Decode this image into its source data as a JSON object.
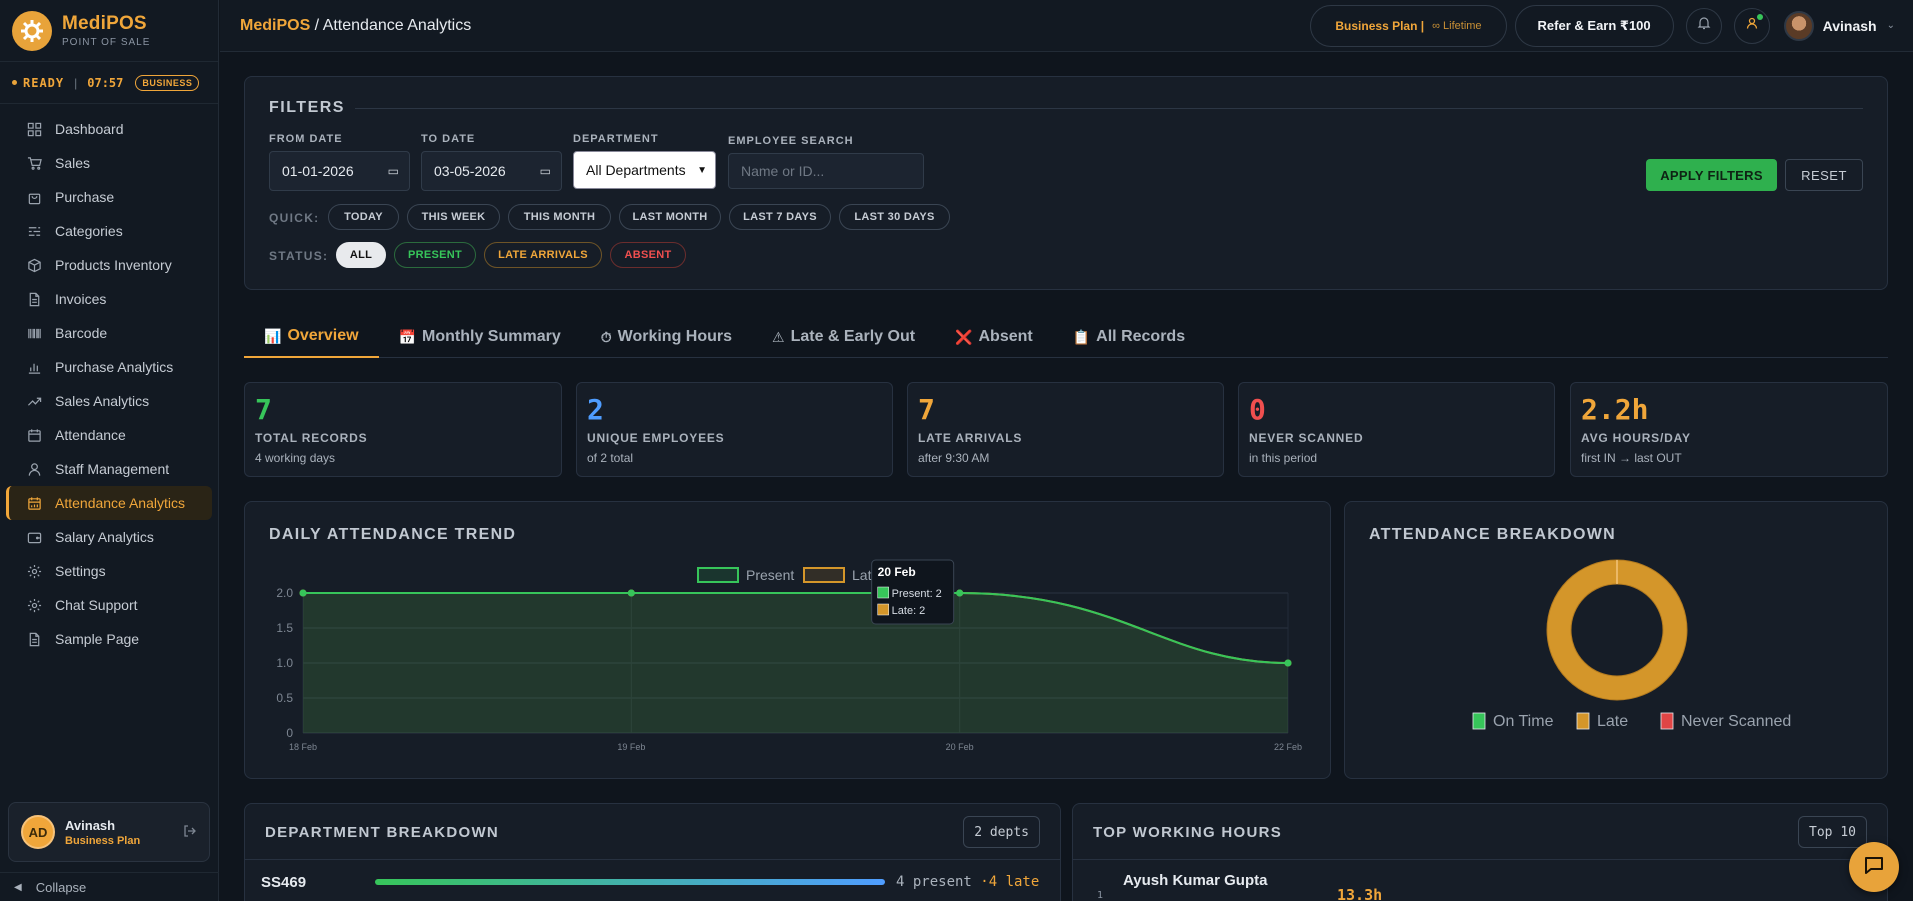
{
  "brand": {
    "title": "MediPOS",
    "subtitle": "POINT OF SALE"
  },
  "status": {
    "state": "READY",
    "time": "07:57",
    "badge": "BUSINESS"
  },
  "sidebar": {
    "items": [
      {
        "label": "Dashboard",
        "icon": "grid-icon"
      },
      {
        "label": "Sales",
        "icon": "cart-icon"
      },
      {
        "label": "Purchase",
        "icon": "bag-icon"
      },
      {
        "label": "Categories",
        "icon": "sliders-icon"
      },
      {
        "label": "Products Inventory",
        "icon": "box-icon"
      },
      {
        "label": "Invoices",
        "icon": "file-icon"
      },
      {
        "label": "Barcode",
        "icon": "barcode-icon"
      },
      {
        "label": "Purchase Analytics",
        "icon": "bar-chart-icon"
      },
      {
        "label": "Sales Analytics",
        "icon": "trending-up-icon"
      },
      {
        "label": "Attendance",
        "icon": "calendar-icon"
      },
      {
        "label": "Staff Management",
        "icon": "user-icon"
      },
      {
        "label": "Attendance Analytics",
        "icon": "calendar-chart-icon",
        "active": true
      },
      {
        "label": "Salary Analytics",
        "icon": "wallet-icon"
      },
      {
        "label": "Settings",
        "icon": "gear-icon"
      },
      {
        "label": "Chat Support",
        "icon": "gear-icon"
      },
      {
        "label": "Sample Page",
        "icon": "file-icon"
      }
    ]
  },
  "user_card": {
    "initials": "AD",
    "name": "Avinash",
    "plan": "Business Plan"
  },
  "collapse_label": "Collapse",
  "topbar": {
    "crumb_root": "MediPOS",
    "crumb_page": " / Attendance Analytics",
    "plan": "Business Plan  |",
    "plan_sub": "∞ Lifetime",
    "refer": "Refer & Earn ₹100",
    "user": "Avinash"
  },
  "filters": {
    "title": "FILTERS",
    "from_label": "FROM DATE",
    "from_value": "01-01-2026",
    "to_label": "TO DATE",
    "to_value": "03-05-2026",
    "dept_label": "DEPARTMENT",
    "dept_value": "All Departments",
    "search_label": "EMPLOYEE SEARCH",
    "search_placeholder": "Name or ID...",
    "apply": "APPLY FILTERS",
    "reset": "RESET",
    "quick_label": "QUICK:",
    "quick": [
      "TODAY",
      "THIS WEEK",
      "THIS MONTH",
      "LAST MONTH",
      "LAST 7 DAYS",
      "LAST 30 DAYS"
    ],
    "status_label": "STATUS:",
    "status": [
      "ALL",
      "PRESENT",
      "LATE ARRIVALS",
      "ABSENT"
    ]
  },
  "tabs": [
    {
      "icon": "📊",
      "label": "Overview",
      "active": true
    },
    {
      "icon": "📅",
      "label": "Monthly Summary"
    },
    {
      "icon": "⏱",
      "label": "Working Hours"
    },
    {
      "icon": "⚠",
      "label": "Late & Early Out"
    },
    {
      "icon": "❌",
      "label": "Absent"
    },
    {
      "icon": "📋",
      "label": "All Records"
    }
  ],
  "stats": [
    {
      "value": "7",
      "label": "TOTAL RECORDS",
      "sub": "4 working days",
      "color": "#37c55a"
    },
    {
      "value": "2",
      "label": "UNIQUE EMPLOYEES",
      "sub": "of 2 total",
      "color": "#4f9dff"
    },
    {
      "value": "7",
      "label": "LATE ARRIVALS",
      "sub": "after 9:30 AM",
      "color": "#f0a63a"
    },
    {
      "value": "0",
      "label": "NEVER SCANNED",
      "sub": "in this period",
      "color": "#f04f4f"
    },
    {
      "value": "2.2h",
      "label": "AVG HOURS/DAY",
      "sub": "first IN → last OUT",
      "color": "#f0a63a"
    }
  ],
  "trend": {
    "title": "DAILY ATTENDANCE TREND",
    "legend_present": "Present",
    "legend_late": "Late",
    "tooltip": {
      "title": "20 Feb",
      "present": "Present: 2",
      "late": "Late: 2"
    }
  },
  "breakdown": {
    "title": "ATTENDANCE BREAKDOWN",
    "legend": [
      "On Time",
      "Late",
      "Never Scanned"
    ]
  },
  "chart_data": [
    {
      "type": "area",
      "categories": [
        "18 Feb",
        "19 Feb",
        "20 Feb",
        "22 Feb"
      ],
      "series": [
        {
          "name": "Present",
          "values": [
            2,
            2,
            2,
            1
          ],
          "color": "#37c55a"
        },
        {
          "name": "Late",
          "values": [
            2,
            2,
            2,
            1
          ],
          "color": "#d4962a"
        }
      ],
      "ylim": [
        0,
        2
      ],
      "yticks": [
        "0",
        "0.5",
        "1.0",
        "1.5",
        "2.0"
      ],
      "grid": true,
      "legend_position": "top"
    },
    {
      "type": "pie",
      "categories": [
        "On Time",
        "Late",
        "Never Scanned"
      ],
      "values": [
        0,
        7,
        0
      ],
      "colors": [
        "#37c55a",
        "#d4962a",
        "#e04545"
      ],
      "legend_position": "bottom"
    }
  ],
  "dept": {
    "title": "DEPARTMENT BREAKDOWN",
    "badge": "2 depts",
    "row_name": "SS469",
    "row_present": "4 present",
    "row_late": " ·4 late"
  },
  "topwh": {
    "title": "TOP WORKING HOURS",
    "badge": "Top 10",
    "rank": "1",
    "name": "Ayush Kumar Gupta",
    "hours": "13.3h"
  }
}
